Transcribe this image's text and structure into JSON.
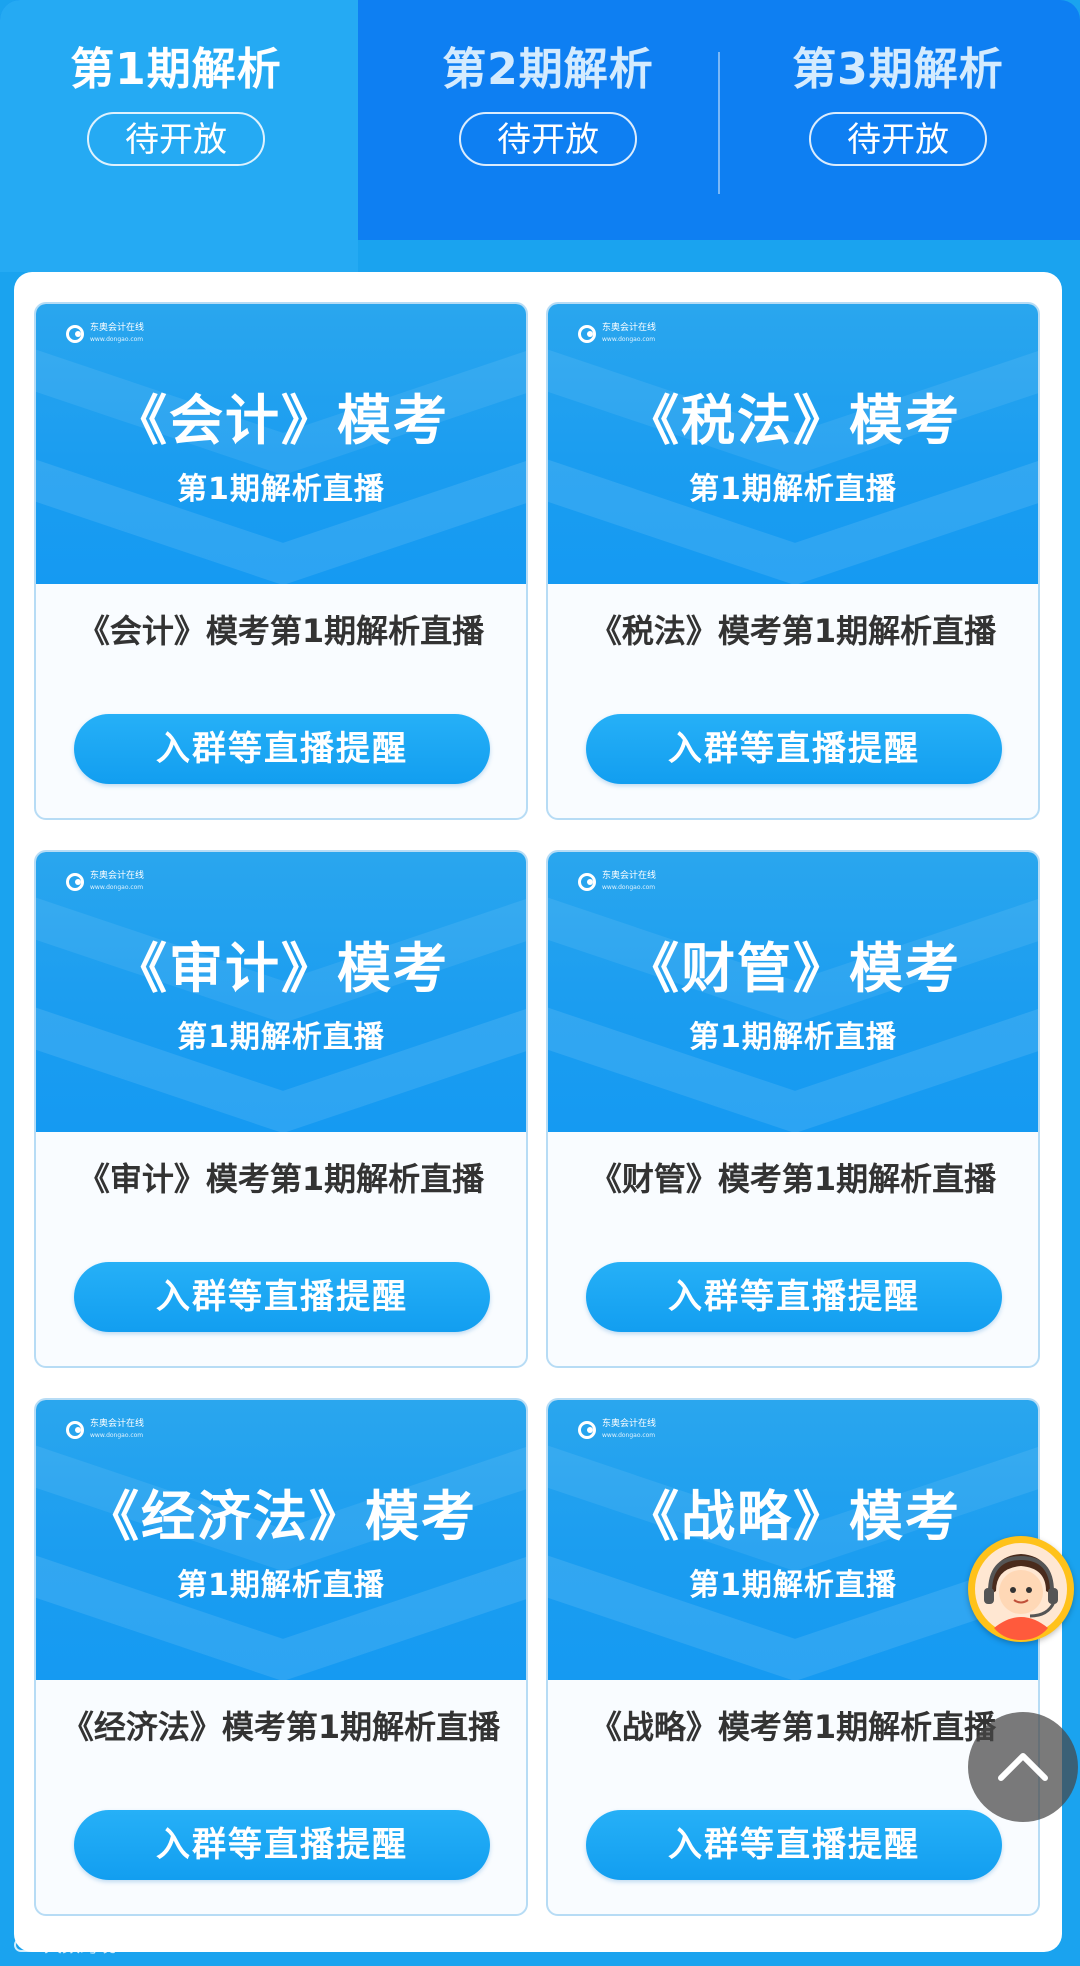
{
  "tabs": [
    {
      "title": "第1期解析",
      "status": "待开放",
      "active": true
    },
    {
      "title": "第2期解析",
      "status": "待开放",
      "active": false
    },
    {
      "title": "第3期解析",
      "status": "待开放",
      "active": false
    }
  ],
  "cards": [
    {
      "banner_title": "《会计》模考",
      "banner_sub": "第1期解析直播",
      "name": "《会计》模考第1期解析直播",
      "button": "入群等直播提醒"
    },
    {
      "banner_title": "《税法》模考",
      "banner_sub": "第1期解析直播",
      "name": "《税法》模考第1期解析直播",
      "button": "入群等直播提醒"
    },
    {
      "banner_title": "《审计》模考",
      "banner_sub": "第1期解析直播",
      "name": "《审计》模考第1期解析直播",
      "button": "入群等直播提醒"
    },
    {
      "banner_title": "《财管》模考",
      "banner_sub": "第1期解析直播",
      "name": "《财管》模考第1期解析直播",
      "button": "入群等直播提醒"
    },
    {
      "banner_title": "《经济法》模考",
      "banner_sub": "第1期解析直播",
      "name": "《经济法》模考第1期解析直播",
      "button": "入群等直播提醒"
    },
    {
      "banner_title": "《战略》模考",
      "banner_sub": "第1期解析直播",
      "name": "《战略》模考第1期解析直播",
      "button": "入群等直播提醒"
    }
  ],
  "logo": {
    "name": "东奥会计在线",
    "url": "www.dongao.com"
  },
  "floating": {
    "support_icon": "customer-service-icon",
    "top_icon": "chevron-up-icon"
  },
  "watermark": {
    "text": "大数跨境"
  },
  "colors": {
    "primary": "#1aa3ef",
    "tab_bar": "#0e7ff2",
    "button": "#129ef0",
    "avatar_bg": "#ffc21a"
  }
}
